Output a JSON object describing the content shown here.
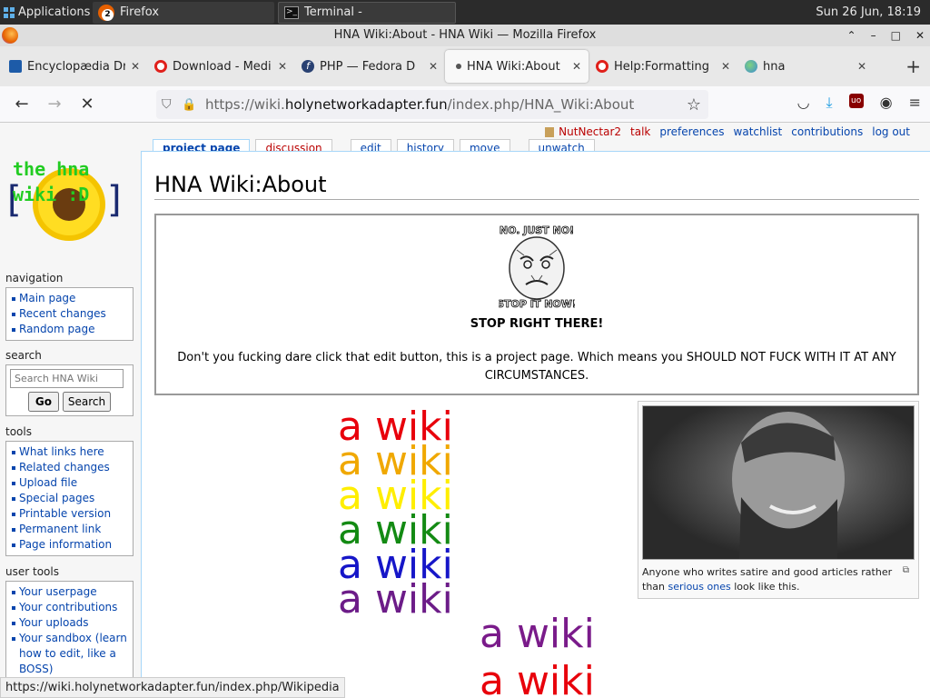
{
  "taskbar": {
    "applications": "Applications",
    "firefox_badge": "2",
    "firefox_label": "Firefox",
    "terminal_label": "Terminal -",
    "clock": "Sun 26 Jun, 18:19"
  },
  "window": {
    "title": "HNA Wiki:About - HNA Wiki — Mozilla Firefox"
  },
  "tabs": [
    {
      "label": "Encyclopædia Dr",
      "color": "#1d5ba8"
    },
    {
      "label": "Download - Medi",
      "color": "#e0201b"
    },
    {
      "label": "PHP — Fedora D",
      "color": "#294172"
    },
    {
      "label": "HNA Wiki:About",
      "color": "#555555"
    },
    {
      "label": "Help:Formatting",
      "color": "#e0201b"
    },
    {
      "label": "hna",
      "color": "#3d8bd4"
    }
  ],
  "nav": {
    "url_prefix": "https://wiki.",
    "url_host": "holynetworkadapter.fun",
    "url_path": "/index.php/HNA_Wiki:About"
  },
  "user_tools": {
    "user": "NutNectar2",
    "talk": "talk",
    "preferences": "preferences",
    "watchlist": "watchlist",
    "contributions": "contributions",
    "logout": "log out"
  },
  "page_tabs": {
    "project_page": "project page",
    "discussion": "discussion",
    "edit": "edit",
    "history": "history",
    "move": "move",
    "unwatch": "unwatch"
  },
  "logo": {
    "line1": "the hna",
    "line2": "wiki :D"
  },
  "sidebar": {
    "navigation_title": "navigation",
    "navigation": [
      "Main page",
      "Recent changes",
      "Random page"
    ],
    "search_title": "search",
    "search_placeholder": "Search HNA Wiki",
    "go": "Go",
    "search": "Search",
    "tools_title": "tools",
    "tools": [
      "What links here",
      "Related changes",
      "Upload file",
      "Special pages",
      "Printable version",
      "Permanent link",
      "Page information"
    ],
    "user_tools_title": "user tools",
    "user_tools": [
      "Your userpage",
      "Your contributions",
      "Your uploads",
      "Your sandbox (learn how to edit, like a BOSS)"
    ]
  },
  "article": {
    "title": "HNA Wiki:About",
    "meme_top": "NO. JUST NO!",
    "meme_bottom": "STOP IT NOW!",
    "stop_heading": "STOP RIGHT THERE!",
    "warning_text": "Don't you fucking dare click that edit button, this is a project page. Which means you SHOULD NOT FUCK WITH IT AT ANY CIRCUMSTANCES.",
    "rainbow_text": "a wiki",
    "rainbow_colors": [
      "#e8000b",
      "#f0a800",
      "#ffee00",
      "#138a13",
      "#1616c8",
      "#6c1c88"
    ],
    "rainbow_colors_2": [
      "#7a1b8a",
      "#e8000b"
    ],
    "caption_before": "Anyone who writes satire and good articles rather than ",
    "caption_link": "serious ones",
    "caption_after": " look like this."
  },
  "statusbar": {
    "url": "https://wiki.holynetworkadapter.fun/index.php/Wikipedia"
  }
}
